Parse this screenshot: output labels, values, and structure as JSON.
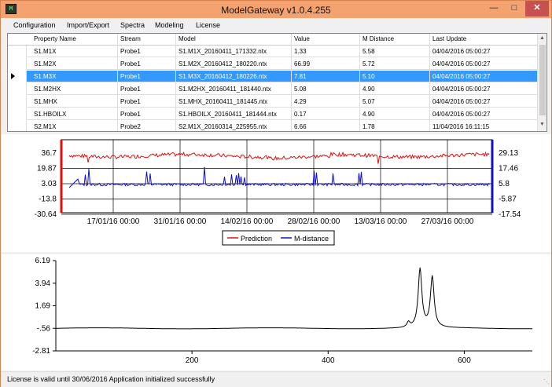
{
  "window": {
    "title": "ModelGateway v1.0.4.255",
    "icon_text": "M"
  },
  "menu": [
    "Configuration",
    "Import/Export",
    "Spectra",
    "Modeling",
    "License"
  ],
  "grid": {
    "columns": [
      "Property Name",
      "Stream",
      "Model",
      "Value",
      "M Distance",
      "Last Update"
    ],
    "rows": [
      [
        "S1.M1X",
        "Probe1",
        "S1.M1X_20160411_171332.ntx",
        "1.33",
        "5.58",
        "04/04/2016 05:00:27"
      ],
      [
        "S1.M2X",
        "Probe1",
        "S1.M2X_20160412_180220.ntx",
        "66.99",
        "5.72",
        "04/04/2016 05:00:27"
      ],
      [
        "S1.M3X",
        "Probe1",
        "S1.M3X_20160412_180226.ntx",
        "7.81",
        "5.10",
        "04/04/2016 05:00:27"
      ],
      [
        "S1.M2HX",
        "Probe1",
        "S1.M2HX_20160411_181440.ntx",
        "5.08",
        "4.90",
        "04/04/2016 05:00:27"
      ],
      [
        "S1.MHX",
        "Probe1",
        "S1.MHX_20160411_181445.ntx",
        "4.29",
        "5.07",
        "04/04/2016 05:00:27"
      ],
      [
        "S1.HBOILX",
        "Probe1",
        "S1.HBOILX_20160411_181444.ntx",
        "0.17",
        "4.90",
        "04/04/2016 05:00:27"
      ],
      [
        "S2.M1X",
        "Probe2",
        "S2.M1X_20160314_225955.ntx",
        "6.66",
        "1.78",
        "11/04/2016 16:11:15"
      ]
    ],
    "selected_row": 2
  },
  "chart_data": [
    {
      "type": "line",
      "x_ticks": [
        "17/01/16 00:00",
        "31/01/16 00:00",
        "14/02/16 00:00",
        "28/02/16 00:00",
        "13/03/16 00:00",
        "27/03/16 00:00"
      ],
      "y_left_ticks": [
        "36.7",
        "19.87",
        "3.03",
        "-13.8",
        "-30.64"
      ],
      "y_right_ticks": [
        "29.13",
        "17.46",
        "5.8",
        "-5.87",
        "-17.54"
      ],
      "ylim_left": [
        -30.64,
        36.7
      ],
      "ylim_right": [
        -17.54,
        29.13
      ],
      "series": [
        {
          "name": "Prediction",
          "color": "#e01010",
          "axis": "left",
          "typical": 22,
          "range": [
            14,
            28
          ]
        },
        {
          "name": "M-distance",
          "color": "#1010c0",
          "axis": "right",
          "typical": 0.5,
          "range": [
            -2,
            14
          ]
        }
      ],
      "grid": true,
      "legend": "bottom"
    },
    {
      "type": "line",
      "x_ticks": [
        "200",
        "400",
        "600"
      ],
      "y_ticks": [
        "6.19",
        "3.94",
        "1.69",
        "-.56",
        "-2.81"
      ],
      "xlim": [
        0,
        700
      ],
      "ylim": [
        -2.81,
        6.19
      ],
      "series": [
        {
          "color": "#000000",
          "baseline": -0.56,
          "peaks": [
            {
              "x": 535,
              "y": 5.3
            },
            {
              "x": 553,
              "y": 4.5
            }
          ]
        }
      ],
      "grid": false
    }
  ],
  "status": {
    "text": "License is valid until 30/06/2016  Application initialized successfully"
  }
}
